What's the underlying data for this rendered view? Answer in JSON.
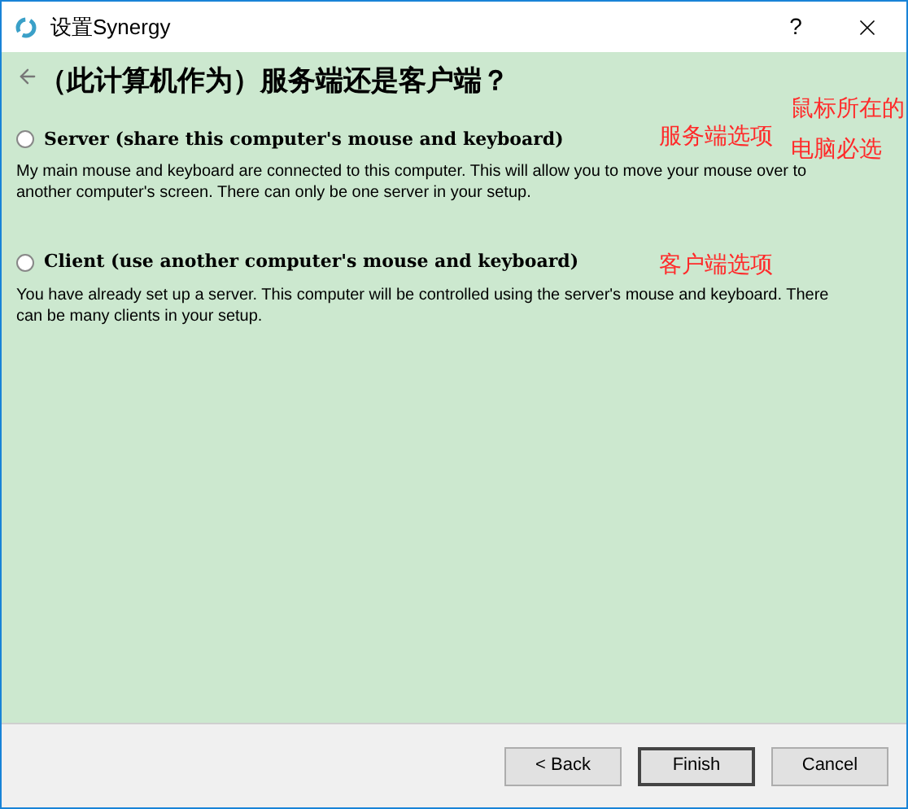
{
  "window": {
    "title": "设置Synergy",
    "help": "?"
  },
  "heading": "（此计算机作为）服务端还是客户端？",
  "options": [
    {
      "label": "Server (share this computer's mouse and keyboard)",
      "selected": false,
      "description": "My main mouse and keyboard are connected to this computer. This will allow you to move your mouse over to another computer's screen. There can only be one server in your setup."
    },
    {
      "label": "Client (use another computer's mouse and keyboard)",
      "selected": false,
      "description": "You have already set up a server. This computer will be controlled using the server's mouse and keyboard. There can be many clients in your setup."
    }
  ],
  "annotations": [
    {
      "text": "鼠标所在的"
    },
    {
      "text": "服务端选项"
    },
    {
      "text": "电脑必选"
    },
    {
      "text": "客户端选项"
    }
  ],
  "buttons": [
    {
      "label": "< Back",
      "default": false
    },
    {
      "label": "Finish",
      "default": true
    },
    {
      "label": "Cancel",
      "default": false
    }
  ]
}
